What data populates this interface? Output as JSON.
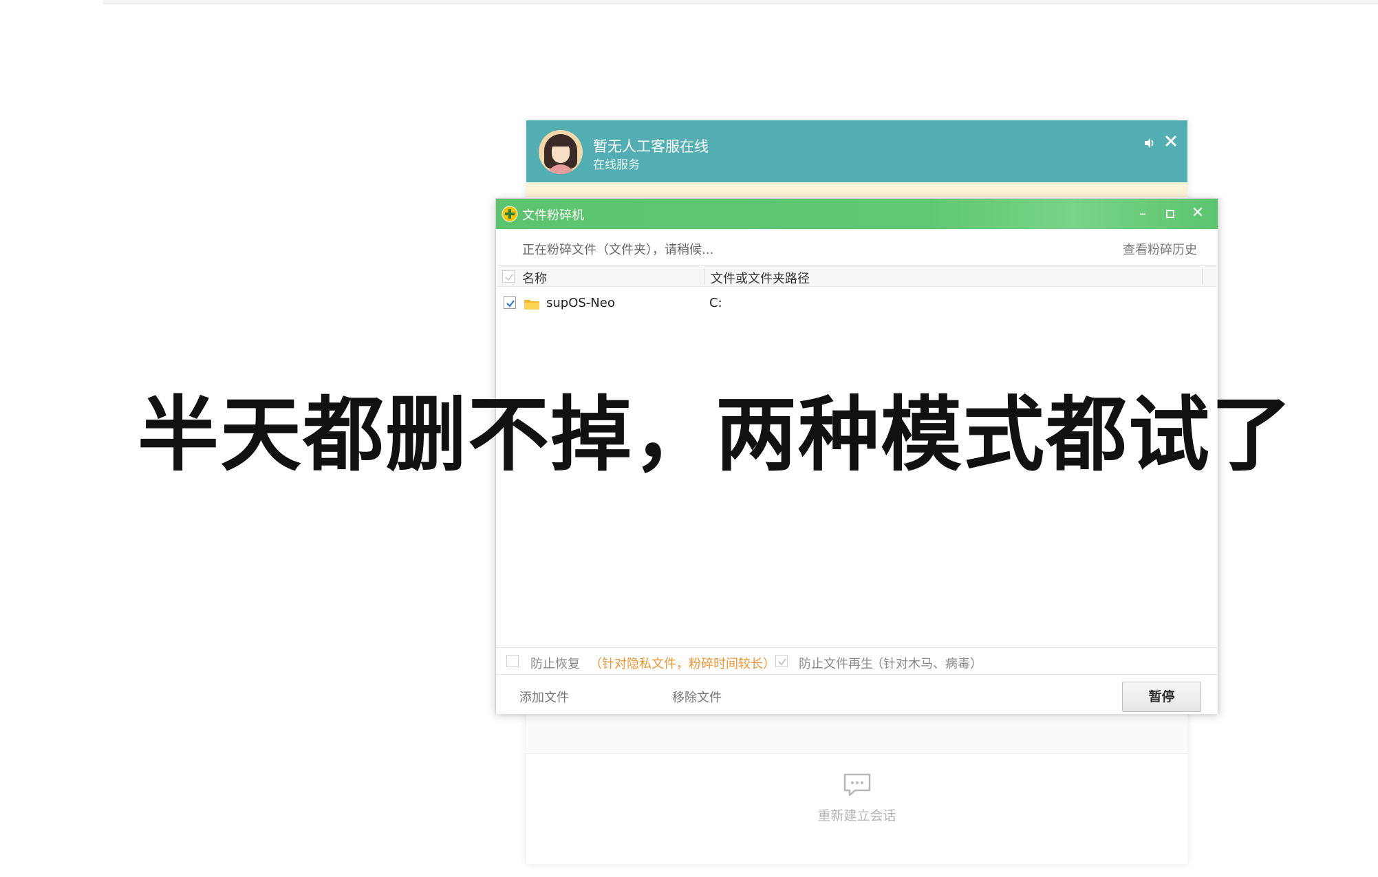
{
  "chat": {
    "title": "暂无人工客服在线",
    "subtitle": "在线服务",
    "reconnect_label": "重新建立会话",
    "icons": {
      "avatar": "agent-avatar",
      "sound": "speaker-icon",
      "close": "close-icon",
      "reconnect": "chat-bubble-icon"
    }
  },
  "shredder": {
    "title": "文件粉碎机",
    "window_controls": {
      "minimize": "–",
      "close": "✕"
    },
    "status_text": "正在粉碎文件（文件夹），请稍候...",
    "history_link": "查看粉碎历史",
    "columns": [
      "名称",
      "文件或文件夹路径"
    ],
    "rows": [
      {
        "checked": true,
        "name": "supOS-Neo",
        "path": "C:"
      }
    ],
    "options": {
      "prevent_recovery_label": "防止恢复",
      "prevent_recovery_note": "（针对隐私文件，粉碎时间较长）",
      "prevent_regen_label": "防止文件再生",
      "prevent_regen_note": "（针对木马、病毒）"
    },
    "buttons": {
      "add_file": "添加文件",
      "remove_file": "移除文件",
      "pause": "暂停"
    },
    "colors": {
      "titlebar": "#5cc46f",
      "warning_note": "#f09535",
      "chat_header": "#52aeb2"
    }
  },
  "caption": "半天都删不掉，两种模式都试了"
}
